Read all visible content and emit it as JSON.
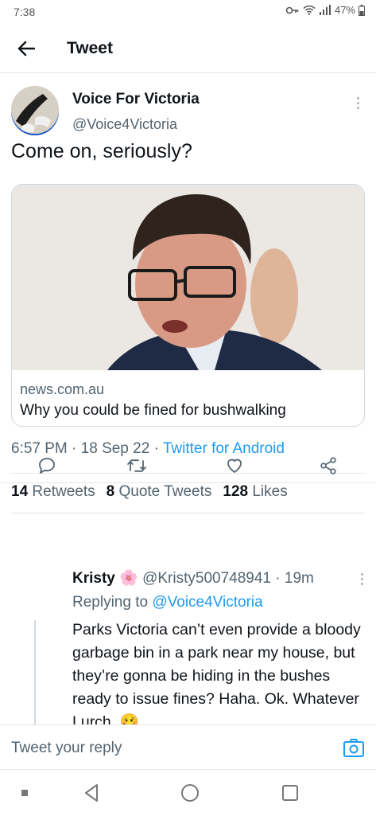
{
  "status": {
    "time": "7:38",
    "battery": "47%",
    "icons": [
      "key-icon",
      "wifi-icon",
      "signal-icon",
      "battery-icon"
    ]
  },
  "header": {
    "title": "Tweet",
    "back_icon": "arrow-left-icon"
  },
  "tweet": {
    "author_name": "Voice For Victoria",
    "author_handle": "@Voice4Victoria",
    "text": "Come on, seriously?",
    "card": {
      "domain": "news.com.au",
      "headline": "Why you could be fined for bushwalking"
    },
    "time": "6:57 PM",
    "date": "18 Sep 22",
    "client": "Twitter for Android",
    "stats": {
      "retweets_count": "14",
      "retweets_label": "Retweets",
      "quotes_count": "8",
      "quotes_label": "Quote Tweets",
      "likes_count": "128",
      "likes_label": "Likes"
    },
    "actions": [
      "reply-icon",
      "retweet-icon",
      "like-icon",
      "share-icon"
    ]
  },
  "reply": {
    "author_name": "Kristy",
    "emoji": "🌸",
    "handle": "@Kristy500748941",
    "age": "19m",
    "replying_prefix": "Replying to",
    "replying_to": "@Voice4Victoria",
    "text": "Parks Victoria can’t even provide a bloody garbage bin in a park near my house, but they’re gonna be hiding in the bushes ready to issue fines? Haha. Ok. Whatever Lurch. 🥴"
  },
  "compose": {
    "placeholder": "Tweet your reply"
  },
  "colors": {
    "accent": "#1d9bf0",
    "text": "#0f1419",
    "secondary": "#536471",
    "divider": "#e6e6e6"
  }
}
